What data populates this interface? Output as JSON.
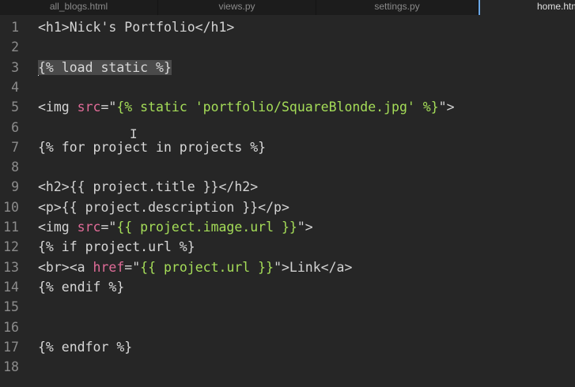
{
  "tabs": [
    {
      "label": "all_blogs.html",
      "active": false
    },
    {
      "label": "views.py",
      "active": false
    },
    {
      "label": "settings.py",
      "active": false
    },
    {
      "label": "home.htm",
      "active": true
    }
  ],
  "editor": {
    "current_line": 3,
    "lines": [
      {
        "n": "1",
        "segments": [
          {
            "t": "<h1>Nick's Portfolio</h1>",
            "c": "tag"
          }
        ]
      },
      {
        "n": "2",
        "segments": []
      },
      {
        "n": "3",
        "segments": [
          {
            "t": "{% load static %}",
            "c": "tpl"
          }
        ]
      },
      {
        "n": "4",
        "segments": []
      },
      {
        "n": "5",
        "segments": [
          {
            "t": "<img ",
            "c": "tag"
          },
          {
            "t": "src",
            "c": "attr"
          },
          {
            "t": "=\"",
            "c": "tag"
          },
          {
            "t": "{% static 'portfolio/SquareBlonde.jpg' %}",
            "c": "str"
          },
          {
            "t": "\">",
            "c": "tag"
          }
        ]
      },
      {
        "n": "6",
        "segments": []
      },
      {
        "n": "7",
        "segments": [
          {
            "t": "{% for project in projects %}",
            "c": "tpl"
          }
        ]
      },
      {
        "n": "8",
        "segments": []
      },
      {
        "n": "9",
        "segments": [
          {
            "t": "<h2>{{ project.title }}</h2>",
            "c": "tag"
          }
        ]
      },
      {
        "n": "10",
        "segments": [
          {
            "t": "<p>{{ project.description }}</p>",
            "c": "tag"
          }
        ]
      },
      {
        "n": "11",
        "segments": [
          {
            "t": "<img ",
            "c": "tag"
          },
          {
            "t": "src",
            "c": "attr"
          },
          {
            "t": "=\"",
            "c": "tag"
          },
          {
            "t": "{{ project.image.url }}",
            "c": "str"
          },
          {
            "t": "\">",
            "c": "tag"
          }
        ]
      },
      {
        "n": "12",
        "segments": [
          {
            "t": "{% if project.url %}",
            "c": "tpl"
          }
        ]
      },
      {
        "n": "13",
        "segments": [
          {
            "t": "<br><a ",
            "c": "tag"
          },
          {
            "t": "href",
            "c": "attr"
          },
          {
            "t": "=\"",
            "c": "tag"
          },
          {
            "t": "{{ project.url }}",
            "c": "str"
          },
          {
            "t": "\">Link</a>",
            "c": "tag"
          }
        ]
      },
      {
        "n": "14",
        "segments": [
          {
            "t": "{% endif %}",
            "c": "tpl"
          }
        ]
      },
      {
        "n": "15",
        "segments": []
      },
      {
        "n": "16",
        "segments": []
      },
      {
        "n": "17",
        "segments": [
          {
            "t": "{% endfor %}",
            "c": "tpl"
          }
        ]
      },
      {
        "n": "18",
        "segments": []
      }
    ]
  },
  "colors": {
    "background": "#262626",
    "tag": "#d4d4d4",
    "attribute": "#e06c98",
    "string": "#a5dd58",
    "active_tab_accent": "#6aa7e6"
  }
}
